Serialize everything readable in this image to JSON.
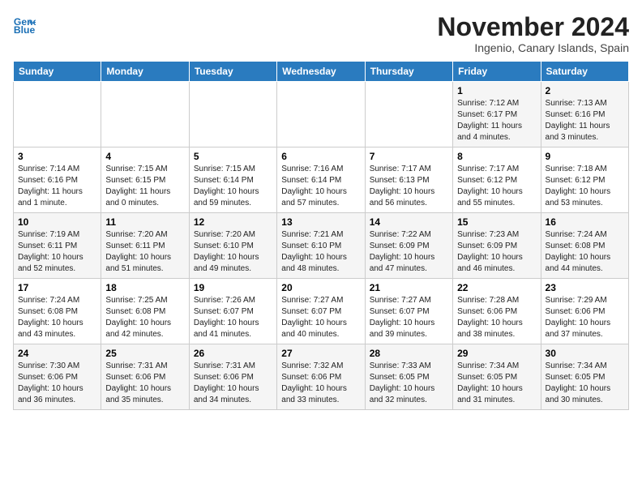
{
  "header": {
    "logo_line1": "General",
    "logo_line2": "Blue",
    "month": "November 2024",
    "location": "Ingenio, Canary Islands, Spain"
  },
  "weekdays": [
    "Sunday",
    "Monday",
    "Tuesday",
    "Wednesday",
    "Thursday",
    "Friday",
    "Saturday"
  ],
  "weeks": [
    [
      {
        "day": "",
        "info": ""
      },
      {
        "day": "",
        "info": ""
      },
      {
        "day": "",
        "info": ""
      },
      {
        "day": "",
        "info": ""
      },
      {
        "day": "",
        "info": ""
      },
      {
        "day": "1",
        "info": "Sunrise: 7:12 AM\nSunset: 6:17 PM\nDaylight: 11 hours\nand 4 minutes."
      },
      {
        "day": "2",
        "info": "Sunrise: 7:13 AM\nSunset: 6:16 PM\nDaylight: 11 hours\nand 3 minutes."
      }
    ],
    [
      {
        "day": "3",
        "info": "Sunrise: 7:14 AM\nSunset: 6:16 PM\nDaylight: 11 hours\nand 1 minute."
      },
      {
        "day": "4",
        "info": "Sunrise: 7:15 AM\nSunset: 6:15 PM\nDaylight: 11 hours\nand 0 minutes."
      },
      {
        "day": "5",
        "info": "Sunrise: 7:15 AM\nSunset: 6:14 PM\nDaylight: 10 hours\nand 59 minutes."
      },
      {
        "day": "6",
        "info": "Sunrise: 7:16 AM\nSunset: 6:14 PM\nDaylight: 10 hours\nand 57 minutes."
      },
      {
        "day": "7",
        "info": "Sunrise: 7:17 AM\nSunset: 6:13 PM\nDaylight: 10 hours\nand 56 minutes."
      },
      {
        "day": "8",
        "info": "Sunrise: 7:17 AM\nSunset: 6:12 PM\nDaylight: 10 hours\nand 55 minutes."
      },
      {
        "day": "9",
        "info": "Sunrise: 7:18 AM\nSunset: 6:12 PM\nDaylight: 10 hours\nand 53 minutes."
      }
    ],
    [
      {
        "day": "10",
        "info": "Sunrise: 7:19 AM\nSunset: 6:11 PM\nDaylight: 10 hours\nand 52 minutes."
      },
      {
        "day": "11",
        "info": "Sunrise: 7:20 AM\nSunset: 6:11 PM\nDaylight: 10 hours\nand 51 minutes."
      },
      {
        "day": "12",
        "info": "Sunrise: 7:20 AM\nSunset: 6:10 PM\nDaylight: 10 hours\nand 49 minutes."
      },
      {
        "day": "13",
        "info": "Sunrise: 7:21 AM\nSunset: 6:10 PM\nDaylight: 10 hours\nand 48 minutes."
      },
      {
        "day": "14",
        "info": "Sunrise: 7:22 AM\nSunset: 6:09 PM\nDaylight: 10 hours\nand 47 minutes."
      },
      {
        "day": "15",
        "info": "Sunrise: 7:23 AM\nSunset: 6:09 PM\nDaylight: 10 hours\nand 46 minutes."
      },
      {
        "day": "16",
        "info": "Sunrise: 7:24 AM\nSunset: 6:08 PM\nDaylight: 10 hours\nand 44 minutes."
      }
    ],
    [
      {
        "day": "17",
        "info": "Sunrise: 7:24 AM\nSunset: 6:08 PM\nDaylight: 10 hours\nand 43 minutes."
      },
      {
        "day": "18",
        "info": "Sunrise: 7:25 AM\nSunset: 6:08 PM\nDaylight: 10 hours\nand 42 minutes."
      },
      {
        "day": "19",
        "info": "Sunrise: 7:26 AM\nSunset: 6:07 PM\nDaylight: 10 hours\nand 41 minutes."
      },
      {
        "day": "20",
        "info": "Sunrise: 7:27 AM\nSunset: 6:07 PM\nDaylight: 10 hours\nand 40 minutes."
      },
      {
        "day": "21",
        "info": "Sunrise: 7:27 AM\nSunset: 6:07 PM\nDaylight: 10 hours\nand 39 minutes."
      },
      {
        "day": "22",
        "info": "Sunrise: 7:28 AM\nSunset: 6:06 PM\nDaylight: 10 hours\nand 38 minutes."
      },
      {
        "day": "23",
        "info": "Sunrise: 7:29 AM\nSunset: 6:06 PM\nDaylight: 10 hours\nand 37 minutes."
      }
    ],
    [
      {
        "day": "24",
        "info": "Sunrise: 7:30 AM\nSunset: 6:06 PM\nDaylight: 10 hours\nand 36 minutes."
      },
      {
        "day": "25",
        "info": "Sunrise: 7:31 AM\nSunset: 6:06 PM\nDaylight: 10 hours\nand 35 minutes."
      },
      {
        "day": "26",
        "info": "Sunrise: 7:31 AM\nSunset: 6:06 PM\nDaylight: 10 hours\nand 34 minutes."
      },
      {
        "day": "27",
        "info": "Sunrise: 7:32 AM\nSunset: 6:06 PM\nDaylight: 10 hours\nand 33 minutes."
      },
      {
        "day": "28",
        "info": "Sunrise: 7:33 AM\nSunset: 6:05 PM\nDaylight: 10 hours\nand 32 minutes."
      },
      {
        "day": "29",
        "info": "Sunrise: 7:34 AM\nSunset: 6:05 PM\nDaylight: 10 hours\nand 31 minutes."
      },
      {
        "day": "30",
        "info": "Sunrise: 7:34 AM\nSunset: 6:05 PM\nDaylight: 10 hours\nand 30 minutes."
      }
    ]
  ]
}
